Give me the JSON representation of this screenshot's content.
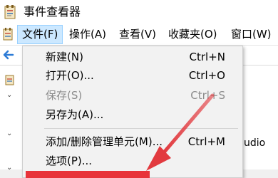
{
  "window": {
    "title": "事件查看器"
  },
  "menubar": {
    "items": [
      {
        "label": "文件(F)",
        "active": true
      },
      {
        "label": "操作(A)"
      },
      {
        "label": "查看(V)"
      },
      {
        "label": "收藏夹(O)"
      },
      {
        "label": "窗口(W)"
      }
    ]
  },
  "file_menu": {
    "items": [
      {
        "label": "新建(N)",
        "shortcut": "Ctrl+N",
        "disabled": false
      },
      {
        "label": "打开(O)...",
        "shortcut": "Ctrl+O",
        "disabled": false
      },
      {
        "label": "保存(S)",
        "shortcut": "Ctrl+S",
        "disabled": true
      },
      {
        "label": "另存为(A)...",
        "shortcut": "",
        "disabled": false
      },
      {
        "label": "添加/删除管理单元(M)...",
        "shortcut": "Ctrl+M",
        "disabled": false
      },
      {
        "label": "选项(P)...",
        "shortcut": "",
        "disabled": false
      }
    ]
  },
  "background": {
    "partial_text": "udio"
  },
  "colors": {
    "menu_highlight": "#cce8ff",
    "annotation_red": "#e8333a"
  },
  "icons": [
    "event-viewer-app-icon",
    "back-arrow-icon",
    "chevron-down-icon"
  ]
}
